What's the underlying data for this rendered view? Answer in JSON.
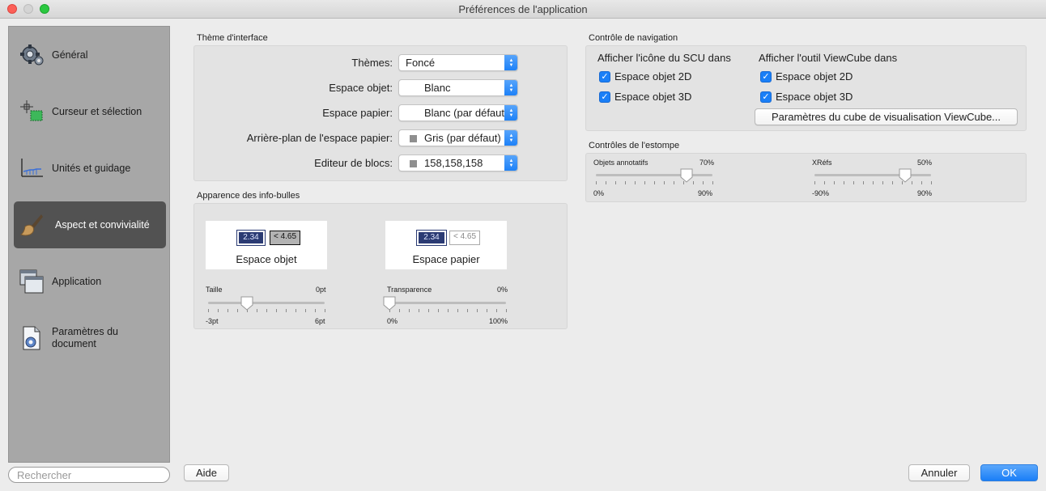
{
  "window": {
    "title": "Préférences de l'application"
  },
  "sidebar": {
    "items": [
      {
        "label": "Général",
        "icon": "gear-icon"
      },
      {
        "label": "Curseur et sélection",
        "icon": "cursor-selection-icon"
      },
      {
        "label": "Unités et guidage",
        "icon": "units-graph-icon"
      },
      {
        "label": "Aspect et convivialité",
        "icon": "paintbrush-icon",
        "active": true
      },
      {
        "label": "Application",
        "icon": "windows-icon"
      },
      {
        "label": "Paramètres du document",
        "icon": "document-gear-icon"
      }
    ],
    "search_placeholder": "Rechercher"
  },
  "theme": {
    "title": "Thème d'interface",
    "rows": [
      {
        "label": "Thèmes:",
        "value": "Foncé",
        "swatch": false
      },
      {
        "label": "Espace objet:",
        "value": "Blanc",
        "swatch": false
      },
      {
        "label": "Espace papier:",
        "value": "Blanc (par défaut)",
        "swatch": false
      },
      {
        "label": "Arrière-plan de l'espace papier:",
        "value": "Gris (par défaut)",
        "swatch": true
      },
      {
        "label": "Editeur de blocs:",
        "value": "158,158,158",
        "swatch": true
      }
    ]
  },
  "tooltips": {
    "title": "Apparence des info-bulles",
    "preview_model": {
      "label": "Espace objet",
      "chip1": "2.34",
      "chip2": "< 4.65"
    },
    "preview_paper": {
      "label": "Espace papier",
      "chip1": "2.34",
      "chip2": "< 4.65"
    },
    "size_slider": {
      "label": "Taille",
      "current": "0pt",
      "min": "-3pt",
      "max": "6pt",
      "level": 0.333
    },
    "transparency_slider": {
      "label": "Transparence",
      "current": "0%",
      "min": "0%",
      "max": "100%",
      "level": 0.0
    }
  },
  "nav": {
    "title": "Contrôle de navigation",
    "ucs_heading": "Afficher l'icône du SCU dans",
    "viewcube_heading": "Afficher l'outil ViewCube dans",
    "ucs_options": [
      {
        "label": "Espace objet 2D",
        "checked": true
      },
      {
        "label": "Espace objet 3D",
        "checked": true
      }
    ],
    "viewcube_options": [
      {
        "label": "Espace objet 2D",
        "checked": true
      },
      {
        "label": "Espace objet 3D",
        "checked": true
      }
    ],
    "viewcube_button": "Paramètres du cube de visualisation ViewCube..."
  },
  "fade": {
    "title": "Contrôles de l'estompe",
    "annot_slider": {
      "label": "Objets annotatifs",
      "current": "70%",
      "min": "0%",
      "max": "90%",
      "level": 0.778
    },
    "xref_slider": {
      "label": "XRéfs",
      "current": "50%",
      "min": "-90%",
      "max": "90%",
      "level": 0.778
    }
  },
  "footer": {
    "help": "Aide",
    "cancel": "Annuler",
    "ok": "OK"
  },
  "check_glyph": "✓"
}
